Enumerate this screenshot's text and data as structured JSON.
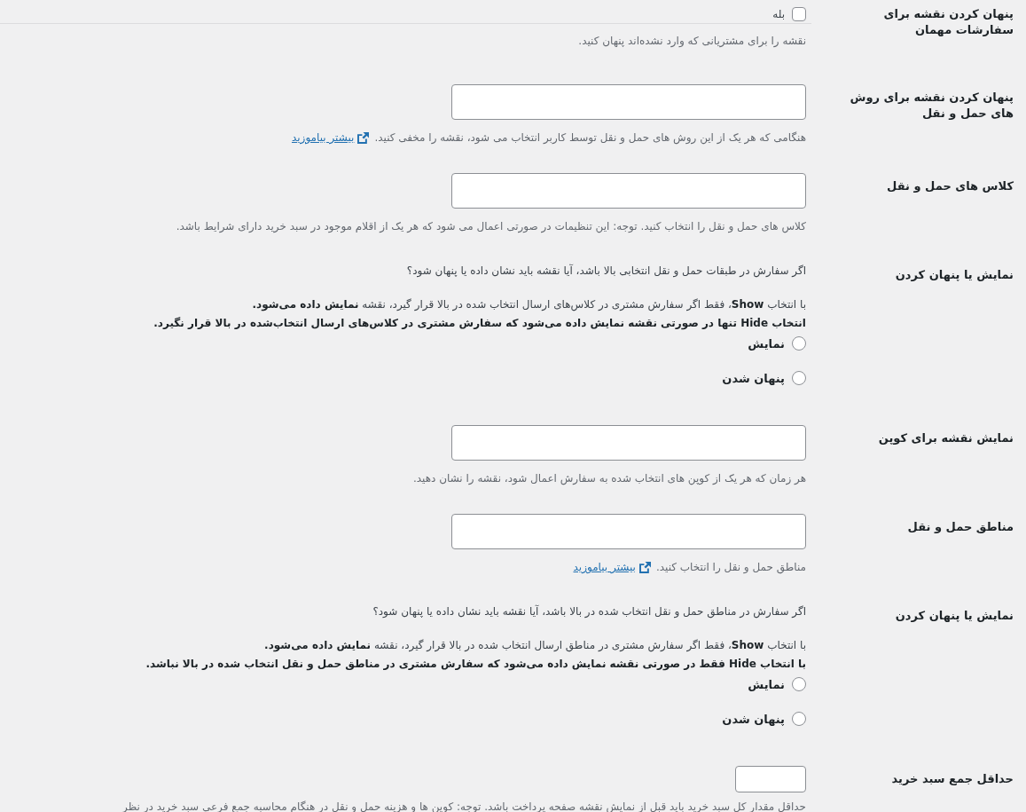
{
  "rows": [
    {
      "kind": "checkbox",
      "label": "پنهان کردن نقشه برای سفارشات مهمان",
      "checkbox": {
        "label": "بله",
        "checked": false
      },
      "description": "نقشه را برای مشتریانی که وارد نشده‌اند پنهان کنید."
    },
    {
      "kind": "select",
      "label": "پنهان کردن نقشه برای روش های حمل و نقل",
      "description": "هنگامی که هر یک از این روش های حمل و نقل توسط کاربر انتخاب می شود، نقشه را مخفی کنید.",
      "link": "بیشتر بیاموزید"
    },
    {
      "kind": "select",
      "label": "کلاس های حمل و نقل",
      "description": "کلاس های حمل و نقل را انتخاب کنید. توجه: این تنظیمات در صورتی اعمال می شود که هر یک از اقلام موجود در سبد خرید دارای شرایط باشد."
    },
    {
      "kind": "radio",
      "label": "نمایش یا پنهان کردن",
      "question": "اگر سفارش در طبقات حمل و نقل انتخابی بالا باشد، آیا نقشه باید نشان داده یا پنهان شود؟",
      "show_note": "با انتخاب **Show**، فقط اگر سفارش مشتری در کلاس‌های ارسال انتخاب شده در بالا قرار گیرد، نقشه **نمایش داده می‌شود.**",
      "hide_note": "انتخاب Hide تنها در صورتی نقشه نمایش داده می‌شود که سفارش مشتری در کلاس‌های ارسال انتخاب‌شده در بالا قرار نگیرد.",
      "options": [
        {
          "label": "نمایش",
          "selected": false
        },
        {
          "label": "پنهان شدن",
          "selected": false
        }
      ]
    },
    {
      "kind": "select",
      "label": "نمایش نقشه برای کوپن",
      "description": "هر زمان که هر یک از کوپن های انتخاب شده به سفارش اعمال شود، نقشه را نشان دهید."
    },
    {
      "kind": "select",
      "label": "مناطق حمل و نقل",
      "description": "مناطق حمل و نقل را انتخاب کنید.",
      "link": "بیشتر بیاموزید"
    },
    {
      "kind": "radio",
      "label": "نمایش یا پنهان کردن",
      "question": "اگر سفارش در مناطق حمل و نقل انتخاب شده در بالا باشد، آیا نقشه باید نشان داده یا پنهان شود؟",
      "show_note": "با انتخاب **Show**، فقط اگر سفارش مشتری در مناطق ارسال انتخاب شده در بالا قرار گیرد، نقشه **نمایش داده می‌شود.**",
      "hide_note": "با انتخاب Hide فقط در صورتی نقشه نمایش داده می‌شود که سفارش مشتری در مناطق حمل و نقل انتخاب شده در بالا نباشد.",
      "options": [
        {
          "label": "نمایش",
          "selected": false
        },
        {
          "label": "پنهان شدن",
          "selected": false
        }
      ]
    },
    {
      "kind": "number",
      "label": "حداقل جمع سبد خرید",
      "description": "حداقل مقدار کل سبد خرید باید قبل از نمایش نقشه صفحه پرداخت باشد. توجه: کوپن ها و هزینه حمل و نقل در هنگام محاسبه جمع فرعی سبد خرید در نظر"
    }
  ]
}
